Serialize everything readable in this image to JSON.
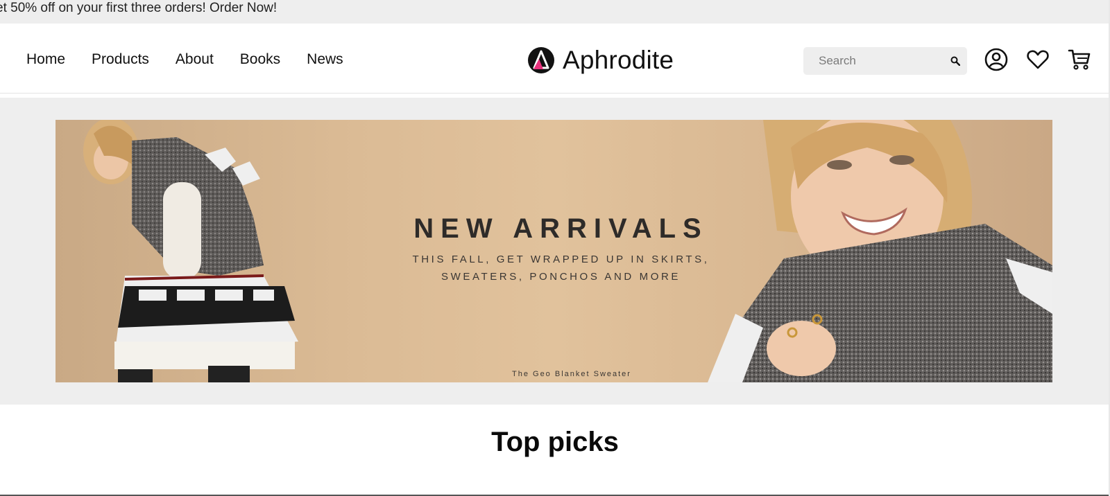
{
  "promo": {
    "text": "et 50% off on your first three orders! Order Now!"
  },
  "nav": {
    "items": [
      {
        "label": "Home"
      },
      {
        "label": "Products"
      },
      {
        "label": "About"
      },
      {
        "label": "Books"
      },
      {
        "label": "News"
      }
    ]
  },
  "brand": {
    "name": "Aphrodite"
  },
  "search": {
    "placeholder": "Search",
    "value": ""
  },
  "icons": {
    "search": "search-icon",
    "account": "user-circle-icon",
    "wishlist": "heart-icon",
    "cart": "cart-icon"
  },
  "hero": {
    "headline": "NEW ARRIVALS",
    "subline_1": "THIS FALL, GET WRAPPED UP IN SKIRTS,",
    "subline_2": "SWEATERS, PONCHOS AND MORE",
    "caption": "The Geo Blanket Sweater"
  },
  "section": {
    "title": "Top picks"
  },
  "colors": {
    "accent": "#e8327d",
    "banner_bg": "#dbbb95",
    "gray_bg": "#eeeeee"
  }
}
